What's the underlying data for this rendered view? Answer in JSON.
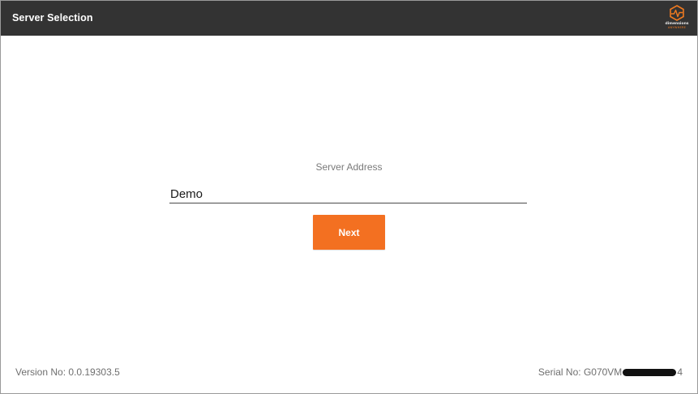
{
  "header": {
    "title": "Server Selection",
    "logo": {
      "name": "dimensions-logo",
      "line1": "dimensions",
      "line2": "ANYWHERE",
      "accent_color": "#f07a20"
    }
  },
  "form": {
    "label": "Server Address",
    "server_address_value": "Demo",
    "next_label": "Next"
  },
  "footer": {
    "version": "Version No: 0.0.19303.5",
    "serial_prefix": "Serial No: G070VM",
    "serial_suffix": "4"
  },
  "colors": {
    "titlebar": "#333333",
    "accent": "#f37021",
    "background": "#ffffff"
  }
}
